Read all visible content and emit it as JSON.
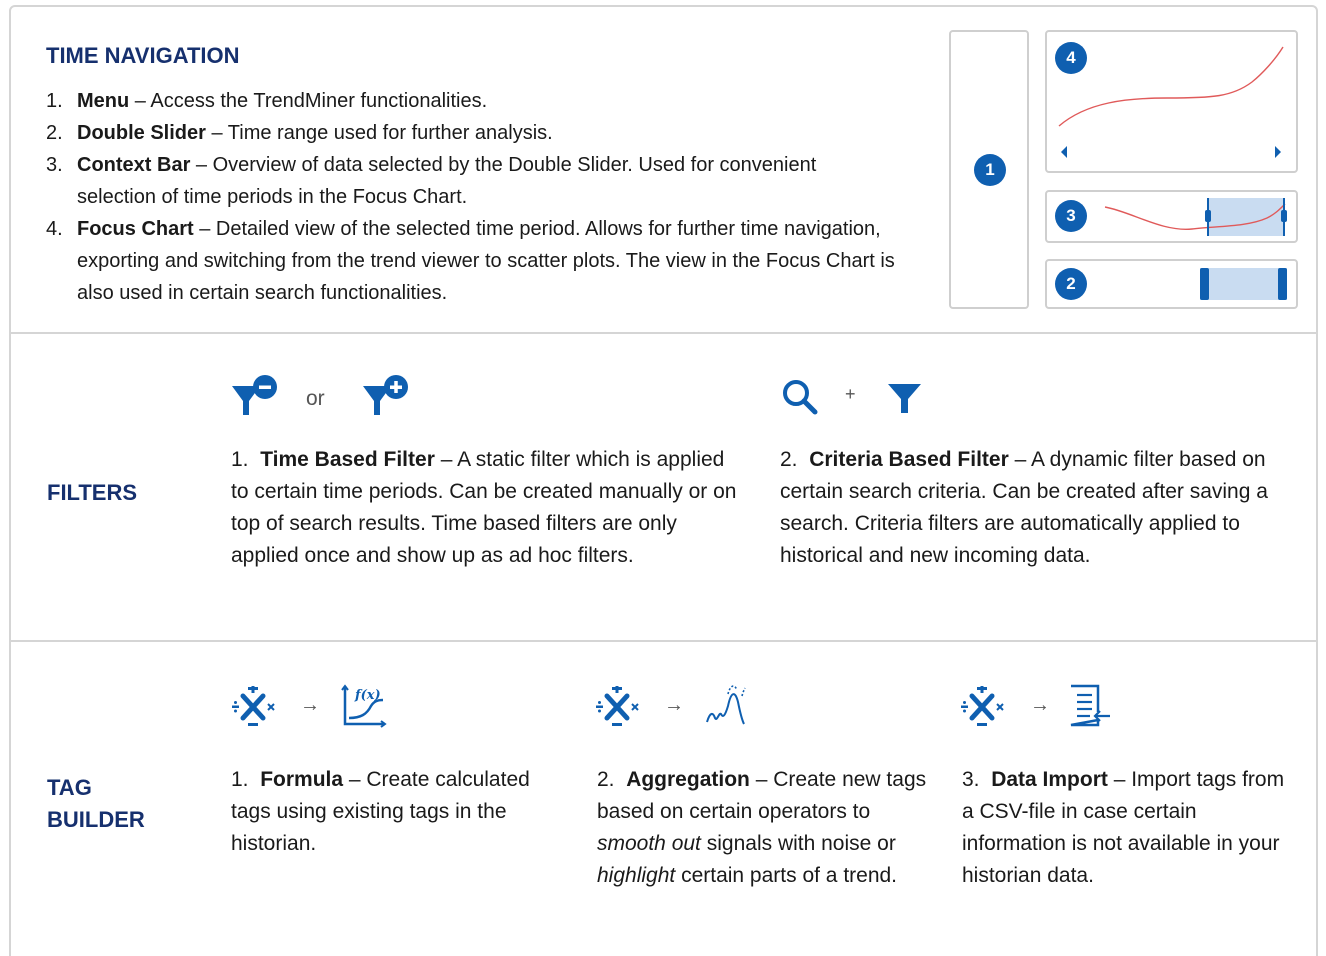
{
  "time_navigation": {
    "heading": "TIME NAVIGATION",
    "items": [
      {
        "num": "1.",
        "term": "Menu",
        "text": " – Access the TrendMiner functionalities."
      },
      {
        "num": "2.",
        "term": "Double Slider",
        "text": " – Time range used for further analysis."
      },
      {
        "num": "3.",
        "term": "Context Bar",
        "text": " – Overview of data selected by the Double Slider. Used for convenient selection of time periods in the Focus Chart."
      },
      {
        "num": "4.",
        "term": "Focus Chart",
        "text": " – Detailed view of the selected time period. Allows for further time navigation, exporting and switching from the trend viewer to scatter plots. The view in the Focus Chart is also used in certain search functionalities."
      }
    ],
    "badges": [
      "1",
      "2",
      "3",
      "4"
    ]
  },
  "filters": {
    "heading": "FILTERS",
    "or_text": "or",
    "plus_text": "+",
    "time_based": {
      "num": "1.",
      "term": "Time Based Filter",
      "text": " – A static filter which is applied to certain time periods. Can be created manually or on top of search results. Time based filters are only applied once and show up as ad hoc filters."
    },
    "criteria_based": {
      "num": "2.",
      "term": "Criteria Based Filter",
      "text": " – A dynamic filter based on certain search criteria. Can be created after saving a search. Criteria filters are automatically applied to historical and new incoming data."
    }
  },
  "tag_builder": {
    "heading_line1": "TAG",
    "heading_line2": "BUILDER",
    "arrow": "→",
    "formula": {
      "num": "1.",
      "term": "Formula",
      "text": " – Create calculated tags using existing tags in the historian."
    },
    "aggregation": {
      "num": "2.",
      "term": "Aggregation",
      "text_1": " –  Create new tags based on certain operators to ",
      "em_1": "smooth out",
      "text_2": " signals with noise or ",
      "em_2": "highlight",
      "text_3": " certain parts of a trend."
    },
    "data_import": {
      "num": "3.",
      "term": "Data Import",
      "text": " – Import tags from a CSV-file in case certain information is not available in your historian data."
    }
  },
  "colors": {
    "accent": "#0f5fb0",
    "heading": "#16306e",
    "trend": "#e05a5a",
    "highlight": "#c9dcf1"
  },
  "icons": [
    "filter-minus-icon",
    "filter-plus-icon",
    "search-icon",
    "filter-icon",
    "operators-icon",
    "formula-chart-icon",
    "aggregation-icon",
    "document-import-icon"
  ]
}
